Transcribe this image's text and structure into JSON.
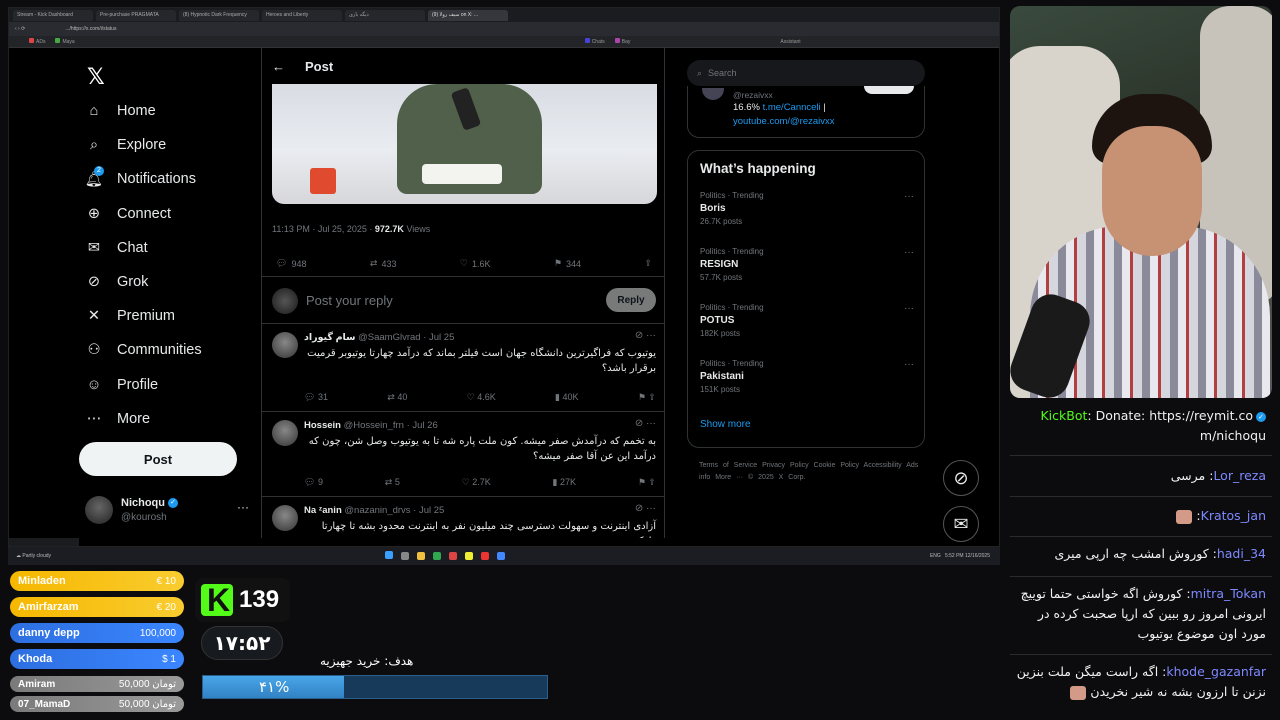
{
  "browser": {
    "tabs": [
      "Stream - Kick Dashboard",
      "Pre-purchase PRAGMATA",
      "(8) Hypnotic Dark Frequency",
      "Heroes and Liberty",
      "دیگه بازی",
      "(9) سیف رولا on X: ..."
    ],
    "url": "https://x.com/i/status/...  ",
    "bookmarks": [
      "ADs",
      "Maya",
      "Chats",
      "Bay",
      "Assistant"
    ]
  },
  "xnav": {
    "items": [
      {
        "label": "Home",
        "icon": "home-icon"
      },
      {
        "label": "Explore",
        "icon": "search-icon"
      },
      {
        "label": "Notifications",
        "icon": "bell-icon"
      },
      {
        "label": "Connect",
        "icon": "add-person-icon"
      },
      {
        "label": "Chat",
        "icon": "envelope-icon"
      },
      {
        "label": "Grok",
        "icon": "grok-icon"
      },
      {
        "label": "Premium",
        "icon": "x-icon"
      },
      {
        "label": "Communities",
        "icon": "people-icon"
      },
      {
        "label": "Profile",
        "icon": "person-icon"
      },
      {
        "label": "More",
        "icon": "more-icon"
      }
    ],
    "notif_count": "2",
    "post_button": "Post",
    "account": {
      "name": "Nichoqu",
      "handle": "@kourosh"
    }
  },
  "post": {
    "header": "Post",
    "timestamp": "11:13 PM · Jul 25, 2025 · ",
    "views_count": "972.7K",
    "views_label": "Views",
    "stats": {
      "replies": "948",
      "reposts": "433",
      "likes": "1.6K",
      "bookmarks": "344"
    },
    "reply_placeholder": "Post your reply",
    "reply_button": "Reply"
  },
  "replies": [
    {
      "name": "سام گیوراد",
      "handle": "@SaamGlvrad · Jul 25",
      "text": "یوتیوب که فراگیرترین دانشگاه جهان است فیلتر بماند که درآمد چهارتا یوتیوبر قرمیت برقرار باشد؟",
      "stats": [
        "31",
        "40",
        "4.6K",
        "40K"
      ]
    },
    {
      "name": "Hossein",
      "handle": "@Hossein_frn · Jul 26",
      "text": "به تخمم که درآمدش صفر میشه. کون ملت پاره شه تا به یوتیوب وصل شن، چون که درآمد این عن آقا صفر میشه؟",
      "stats": [
        "9",
        "5",
        "2.7K",
        "27K"
      ]
    },
    {
      "name": "Na ᶻanin",
      "handle": "@nazanin_drvs · Jul 25",
      "text": "آزادی اینترنت و سهولت دسترسی چند میلیون نفر به اینترنت محدود بشه تا چهارتا دلقک",
      "stats": []
    }
  ],
  "right": {
    "search_placeholder": "Search",
    "bio": {
      "handle": "@rezaivxx",
      "percent": "16.6%",
      "link1": "t.me/Cannceli",
      "link2": "youtube.com/@rezaivxx"
    },
    "happening_title": "What’s happening",
    "trends": [
      {
        "category": "Politics · Trending",
        "title": "Boris",
        "posts": "26.7K posts"
      },
      {
        "category": "Politics · Trending",
        "title": "RESIGN",
        "posts": "57.7K posts"
      },
      {
        "category": "Politics · Trending",
        "title": "POTUS",
        "posts": "182K posts"
      },
      {
        "category": "Politics · Trending",
        "title": "Pakistani",
        "posts": "151K posts"
      }
    ],
    "show_more": "Show more",
    "footer": "Terms of Service  Privacy Policy  Cookie Policy  Accessibility  Ads info  More ···  © 2025 X Corp."
  },
  "taskbar": {
    "weather": "Partly cloudy",
    "time": "5:52 PM",
    "date": "12/16/2025",
    "lang": "ENG"
  },
  "chat": [
    {
      "user": "KickBot",
      "text": "Donate: https://reymit.co m/nichoqu",
      "verified": true
    },
    {
      "user": "Lor_reza",
      "text": "مرسی"
    },
    {
      "user": "Kratos_jan",
      "text": ""
    },
    {
      "user": "hadi_34",
      "text": "کوروش امشب چه ارپی میری"
    },
    {
      "user": "mitra_Tokan",
      "text": "کوروش اگه خواستی حتما توییچ ایرونی امروز رو ببین که ارپا صحبت کرده در مورد اون موضوع یوتیوب"
    },
    {
      "user": "khode_gazanfar",
      "text": "اگه راست میگن ملت بنزین نزنن تا ارزون بشه نه شیر نخریدن"
    }
  ],
  "donors": [
    {
      "name": "Minladen",
      "amount": "€ 10",
      "tier": "gold"
    },
    {
      "name": "Amirfarzam",
      "amount": "€ 20",
      "tier": "gold"
    },
    {
      "name": "danny depp",
      "amount": "100,000",
      "tier": "blue"
    },
    {
      "name": "Khoda",
      "amount": "$ 1",
      "tier": "blue"
    },
    {
      "name": "Amiram",
      "amount": "50,000 تومان",
      "tier": "gray"
    },
    {
      "name": "07_MamaD",
      "amount": "50,000 تومان",
      "tier": "gray"
    }
  ],
  "kick": {
    "viewers": "139",
    "clock": "۱۷:۵۲"
  },
  "goal": {
    "label": "هدف: خرید جهیزیه",
    "percent_text": "۴۱%",
    "fraction": 0.41
  },
  "colors": {
    "x_blue": "#1d9bf0",
    "kick_green": "#53fc18",
    "chat_user": "#7d89ff"
  }
}
